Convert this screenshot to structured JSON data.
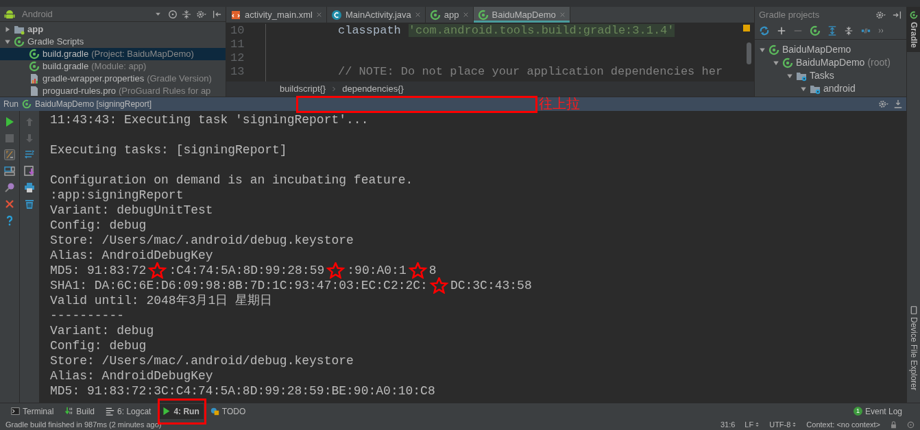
{
  "project_panel": {
    "view": "Android",
    "tree": [
      {
        "label": "app",
        "kind": "module",
        "expanded": false,
        "selected": false
      },
      {
        "label": "Gradle Scripts",
        "kind": "gradle",
        "expanded": true,
        "selected": false,
        "children": [
          {
            "label": "build.gradle",
            "note": "(Project: BaiduMapDemo)",
            "kind": "gradle",
            "selected": true
          },
          {
            "label": "build.gradle",
            "note": "(Module: app)",
            "kind": "gradle",
            "selected": false
          },
          {
            "label": "gradle-wrapper.properties",
            "note": "(Gradle Version)",
            "kind": "properties",
            "selected": false
          },
          {
            "label": "proguard-rules.pro",
            "note": "(ProGuard Rules for ap",
            "kind": "file",
            "selected": false
          }
        ]
      }
    ]
  },
  "editor": {
    "tabs": [
      {
        "label": "activity_main.xml",
        "kind": "xml",
        "selected": false
      },
      {
        "label": "MainActivity.java",
        "kind": "class",
        "selected": false
      },
      {
        "label": "app",
        "kind": "gradle",
        "selected": false
      },
      {
        "label": "BaiduMapDemo",
        "kind": "gradle",
        "selected": true
      }
    ],
    "lines": [
      {
        "number": "10",
        "segments": [
          {
            "kind": "plain",
            "text": "classpath"
          },
          {
            "kind": "string",
            "text": "'com.android.tools.build:gradle:3.1.4'"
          }
        ]
      },
      {
        "number": "11"
      },
      {
        "number": "12"
      },
      {
        "number": "13",
        "segments": [
          {
            "kind": "comment",
            "text": "// NOTE: Do not place your application dependencies her"
          }
        ]
      }
    ],
    "breadcrumbs": [
      "buildscript{}",
      "dependencies{}"
    ]
  },
  "gradle_panel": {
    "title": "Gradle projects",
    "tree": [
      {
        "label": "BaiduMapDemo",
        "kind": "gradle",
        "expanded": true,
        "children": [
          {
            "label": "BaiduMapDemo",
            "note": "(root)",
            "kind": "gradle",
            "expanded": true,
            "children": [
              {
                "label": "Tasks",
                "kind": "tasks",
                "expanded": true,
                "children": [
                  {
                    "label": "android",
                    "kind": "tasks",
                    "expanded": true
                  }
                ]
              }
            ]
          }
        ]
      }
    ]
  },
  "side_tabs": [
    {
      "label": "Gradle",
      "selected": true
    },
    {
      "label": "Device File Explorer",
      "selected": false
    }
  ],
  "run_panel": {
    "title": "Run",
    "config": "BaiduMapDemo [signingReport]",
    "drag_hint": "往上拉",
    "console": [
      {
        "text": "11:43:43: Executing task 'signingReport'..."
      },
      {
        "kind": "blank"
      },
      {
        "text": "Executing tasks: [signingReport]"
      },
      {
        "kind": "blank"
      },
      {
        "text": "Configuration on demand is an incubating feature."
      },
      {
        "text": ":app:signingReport"
      },
      {
        "text": "Variant: debugUnitTest"
      },
      {
        "text": "Config: debug"
      },
      {
        "text": "Store: /Users/mac/.android/debug.keystore"
      },
      {
        "text": "Alias: AndroidDebugKey"
      },
      {
        "segments": [
          {
            "kind": "text",
            "text": "MD5: 91:83:72"
          },
          {
            "kind": "star"
          },
          {
            "kind": "text",
            "text": ":C4:74:5A:8D:99:28:59"
          },
          {
            "kind": "star"
          },
          {
            "kind": "text",
            "text": ":90:A0:1"
          },
          {
            "kind": "star"
          },
          {
            "kind": "text",
            "text": "8"
          }
        ]
      },
      {
        "segments": [
          {
            "kind": "text",
            "text": "SHA1: DA:6C:6E:D6:09:98:8B:7D:1C:93:47:03:EC:C2:2C:"
          },
          {
            "kind": "star"
          },
          {
            "kind": "text",
            "text": "DC:3C:43:58"
          }
        ]
      },
      {
        "text": "Valid until: 2048年3月1日 星期日"
      },
      {
        "text": "----------"
      },
      {
        "text": "Variant: debug"
      },
      {
        "text": "Config: debug"
      },
      {
        "text": "Store: /Users/mac/.android/debug.keystore"
      },
      {
        "text": "Alias: AndroidDebugKey"
      },
      {
        "text": "MD5: 91:83:72:3C:C4:74:5A:8D:99:28:59:BE:90:A0:10:C8"
      }
    ]
  },
  "tool_windows": [
    {
      "label": "Terminal",
      "kind": "terminal",
      "selected": false
    },
    {
      "label": "Build",
      "kind": "build",
      "selected": false
    },
    {
      "label": "6: Logcat",
      "kind": "logcat",
      "selected": false
    },
    {
      "label": "4: Run",
      "kind": "run",
      "selected": true
    },
    {
      "label": "TODO",
      "kind": "todo",
      "selected": false
    }
  ],
  "event_log": {
    "label": "Event Log",
    "count": "1"
  },
  "status_bar": {
    "message": "Gradle build finished in 987ms (2 minutes ago)",
    "position": "31:6",
    "line_separator": "LF",
    "encoding": "UTF-8",
    "context": "Context: <no context>"
  }
}
